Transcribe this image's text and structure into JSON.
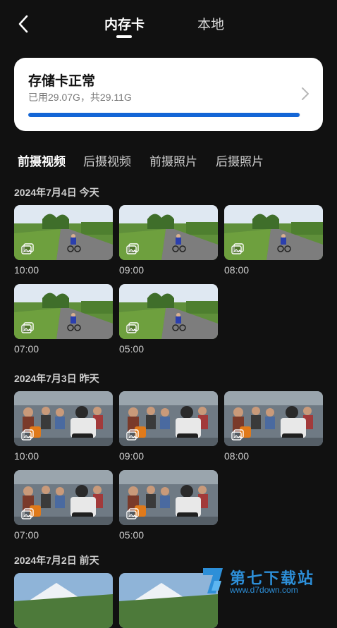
{
  "header": {
    "tabs": [
      {
        "label": "内存卡",
        "active": true
      },
      {
        "label": "本地",
        "active": false
      }
    ]
  },
  "storage": {
    "title": "存储卡正常",
    "usage_text": "已用29.07G，共29.11G",
    "used_fraction": 0.998,
    "bar_color": "#1466d6"
  },
  "categories": [
    "前摄视频",
    "后摄视频",
    "前摄照片",
    "后摄照片"
  ],
  "active_category": 0,
  "groups": [
    {
      "date": "2024年7月4日  今天",
      "scene": "cyclist",
      "times": [
        "10:00",
        "09:00",
        "08:00",
        "07:00",
        "05:00"
      ]
    },
    {
      "date": "2024年7月3日  昨天",
      "scene": "traffic",
      "times": [
        "10:00",
        "09:00",
        "08:00",
        "07:00",
        "05:00"
      ]
    },
    {
      "date": "2024年7月2日  前天",
      "scene": "mountain",
      "times": []
    }
  ],
  "watermark": {
    "text": "第七下载站",
    "url": "www.d7down.com"
  }
}
